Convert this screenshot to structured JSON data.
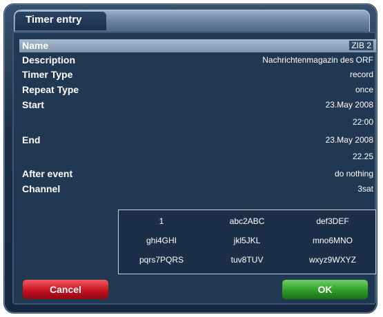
{
  "dialog": {
    "title": "Timer entry"
  },
  "fields": [
    {
      "label": "Name",
      "value": "ZIB 2"
    },
    {
      "label": "Description",
      "value": "Nachrichtenmagazin des ORF"
    },
    {
      "label": "Timer Type",
      "value": "record"
    },
    {
      "label": "Repeat Type",
      "value": "once"
    },
    {
      "label": "Start",
      "date": "23.May 2008",
      "time": "22:00"
    },
    {
      "label": "End",
      "date": "23.May 2008",
      "time": "22.25"
    },
    {
      "label": "After event",
      "value": "do nothing"
    },
    {
      "label": "Channel",
      "value": "3sat"
    }
  ],
  "keypad": {
    "keys": [
      "1",
      "abc2ABC",
      "def3DEF",
      "ghi4GHI",
      "jkl5JKL",
      "mno6MNO",
      "pqrs7PQRS",
      "tuv8TUV",
      "wxyz9WXYZ"
    ]
  },
  "buttons": {
    "cancel": "Cancel",
    "ok": "OK"
  },
  "colors": {
    "cancel": "#c8121f",
    "ok": "#2f9d2a",
    "selection": "#9bb0c8"
  }
}
